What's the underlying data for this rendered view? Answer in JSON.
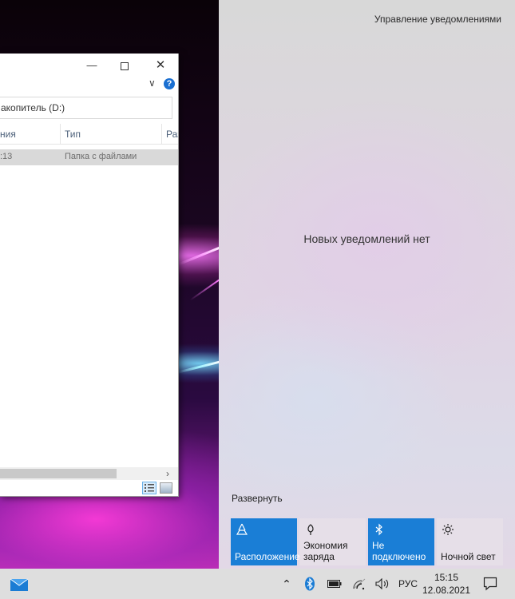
{
  "explorer": {
    "address_text": "акопитель (D:)",
    "columns": [
      "ния",
      "Тип",
      "Раз"
    ],
    "row": {
      "date_fragment": ":13",
      "type": "Папка с файлами"
    },
    "help_label": "?"
  },
  "action_center": {
    "manage_link": "Управление уведомлениями",
    "no_notifications": "Новых уведомлений нет",
    "expand_link": "Развернуть",
    "tiles": [
      {
        "label": "Расположение",
        "state": "on",
        "icon": "location-icon"
      },
      {
        "label": "Экономия заряда",
        "state": "off",
        "icon": "battery-saver-icon"
      },
      {
        "label": "Не подключено",
        "state": "on",
        "icon": "bluetooth-icon"
      },
      {
        "label": "Ночной свет",
        "state": "off",
        "icon": "night-light-icon"
      }
    ]
  },
  "taskbar": {
    "language": "РУС",
    "time": "15:15",
    "date": "12.08.2021"
  },
  "colors": {
    "accent": "#1a7ed6",
    "taskbar": "#dedede"
  }
}
